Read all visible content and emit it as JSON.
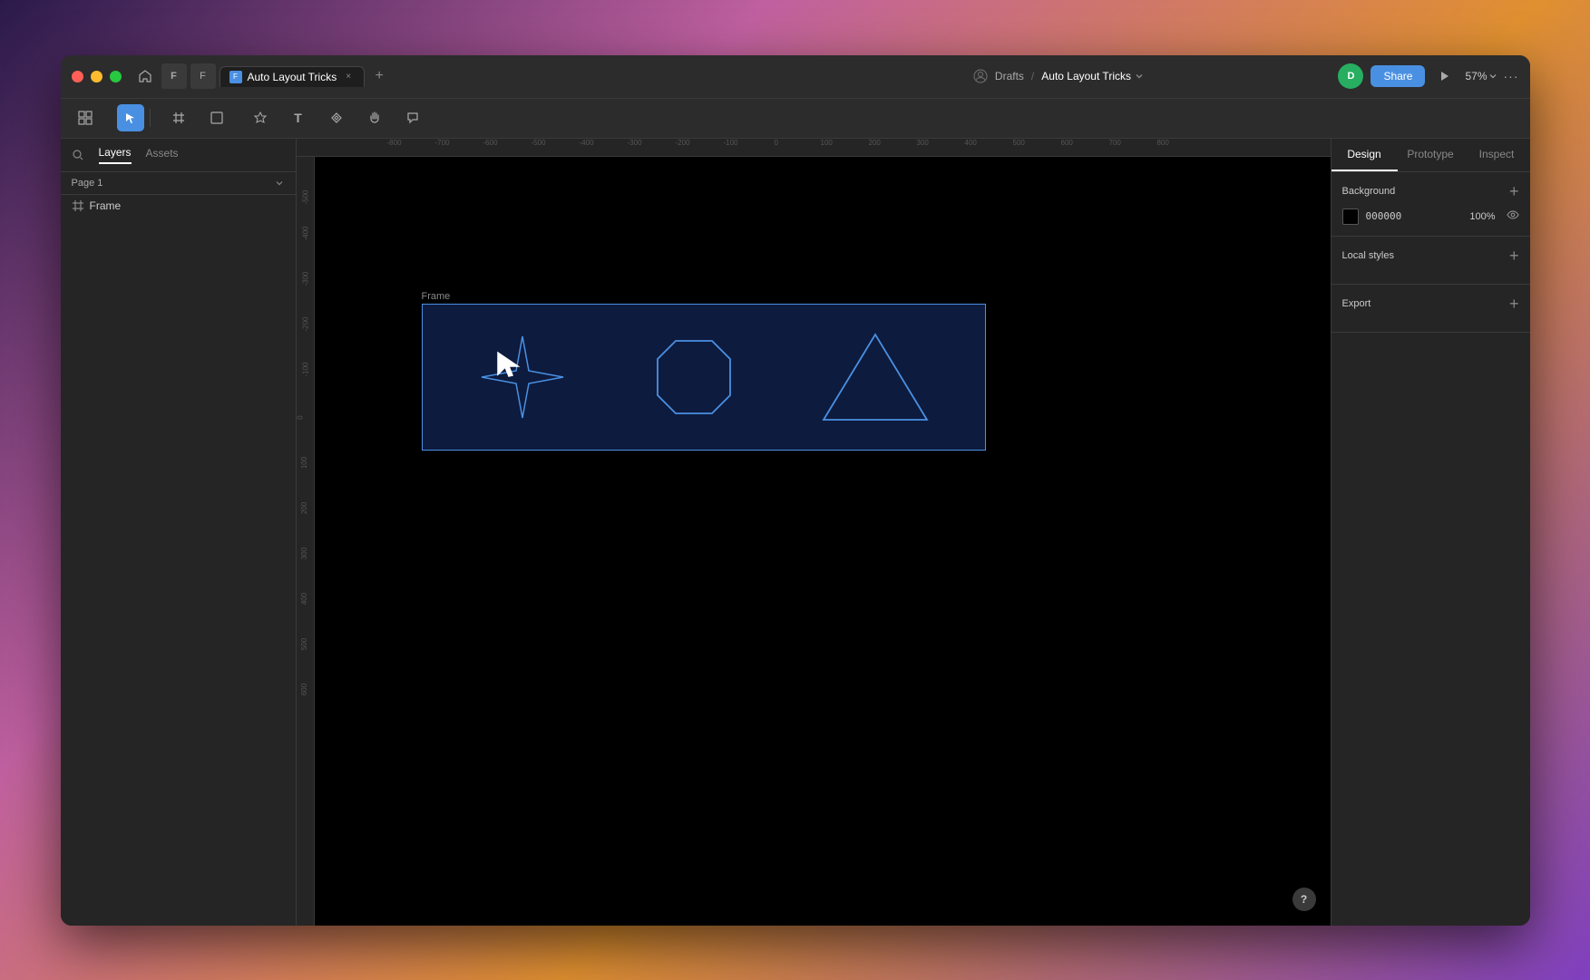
{
  "window": {
    "title": "Auto Layout Tricks",
    "tab_label": "Auto Layout Tricks",
    "zoom": "57%",
    "breadcrumb_drafts": "Drafts",
    "breadcrumb_sep": "/",
    "breadcrumb_file": "Auto Layout Tricks"
  },
  "toolbar": {
    "tools": [
      {
        "name": "grid-tool",
        "icon": "⊞",
        "active": false
      },
      {
        "name": "select-tool",
        "icon": "▶",
        "active": true
      },
      {
        "name": "frame-tool",
        "icon": "⬚",
        "active": false
      },
      {
        "name": "shape-tool",
        "icon": "□",
        "active": false
      },
      {
        "name": "pen-tool",
        "icon": "✏",
        "active": false
      },
      {
        "name": "text-tool",
        "icon": "T",
        "active": false
      },
      {
        "name": "component-tool",
        "icon": "❋",
        "active": false
      },
      {
        "name": "hand-tool",
        "icon": "✋",
        "active": false
      },
      {
        "name": "comment-tool",
        "icon": "💬",
        "active": false
      }
    ]
  },
  "left_panel": {
    "tabs": [
      {
        "name": "layers-tab",
        "label": "Layers",
        "active": true
      },
      {
        "name": "assets-tab",
        "label": "Assets",
        "active": false
      }
    ],
    "page": "Page 1",
    "layers": [
      {
        "name": "frame-layer",
        "label": "Frame",
        "icon": "▤"
      }
    ]
  },
  "canvas": {
    "frame_label": "Frame",
    "ruler_marks": [
      "-800",
      "-700",
      "-600",
      "-500",
      "-400",
      "-300",
      "-200",
      "-100",
      "0",
      "100",
      "200",
      "300",
      "400",
      "500",
      "600",
      "700",
      "800"
    ],
    "shapes": [
      {
        "name": "star-shape",
        "type": "star"
      },
      {
        "name": "octagon-shape",
        "type": "octagon"
      },
      {
        "name": "triangle-shape",
        "type": "triangle"
      }
    ]
  },
  "right_panel": {
    "tabs": [
      {
        "name": "design-tab",
        "label": "Design",
        "active": true
      },
      {
        "name": "prototype-tab",
        "label": "Prototype",
        "active": false
      },
      {
        "name": "inspect-tab",
        "label": "Inspect",
        "active": false
      }
    ],
    "sections": {
      "background": {
        "title": "Background",
        "color_hex": "000000",
        "opacity": "100%",
        "add_label": "+"
      },
      "local_styles": {
        "title": "Local styles",
        "add_label": "+"
      },
      "export": {
        "title": "Export",
        "add_label": "+"
      }
    }
  },
  "title_bar": {
    "user_initial": "D",
    "share_label": "Share",
    "more_label": "···"
  },
  "help": {
    "label": "?"
  }
}
